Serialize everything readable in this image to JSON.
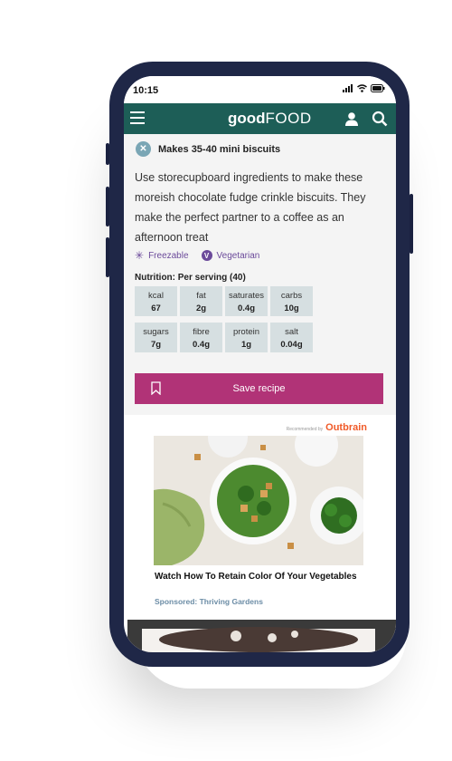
{
  "status": {
    "time": "10:15"
  },
  "header": {
    "logo_bold": "good",
    "logo_light": "FOOD"
  },
  "recipe": {
    "makes": "Makes 35-40 mini biscuits",
    "description": "Use storecupboard ingredients to make these moreish chocolate fudge crinkle biscuits. They make the perfect partner to a coffee as an afternoon treat",
    "tags": [
      "Freezable",
      "Vegetarian"
    ],
    "nutrition_title": "Nutrition: Per serving (40)",
    "nutrition": [
      {
        "label": "kcal",
        "value": "67"
      },
      {
        "label": "fat",
        "value": "2g"
      },
      {
        "label": "saturates",
        "value": "0.4g"
      },
      {
        "label": "carbs",
        "value": "10g"
      },
      {
        "label": "sugars",
        "value": "7g"
      },
      {
        "label": "fibre",
        "value": "0.4g"
      },
      {
        "label": "protein",
        "value": "1g"
      },
      {
        "label": "salt",
        "value": "0.04g"
      }
    ],
    "save_label": "Save recipe"
  },
  "ad": {
    "recommended_by": "Recommended by",
    "brand": "Outbrain",
    "title": "Watch How To Retain Color Of Your Vegetables",
    "sponsored": "Sponsored: Thriving Gardens"
  },
  "colors": {
    "header": "#1d5e57",
    "save_button": "#b13377",
    "tag_purple": "#6b4a9a",
    "phone_frame": "#1f2747"
  }
}
